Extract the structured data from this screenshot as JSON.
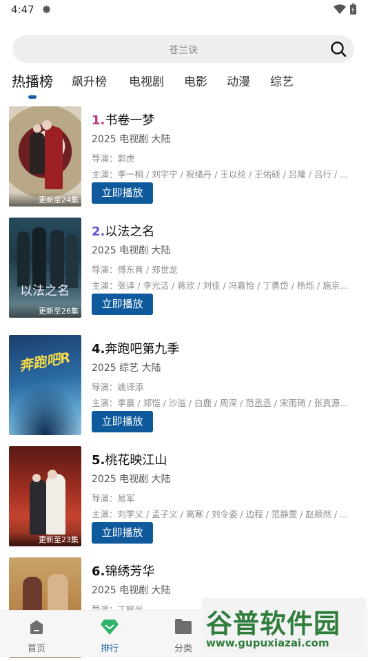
{
  "status": {
    "time": "4:47"
  },
  "search": {
    "placeholder": "苍兰诀"
  },
  "tabs": [
    {
      "label": "热播榜"
    },
    {
      "label": "飙升榜"
    },
    {
      "label": "电视剧"
    },
    {
      "label": "电影"
    },
    {
      "label": "动漫"
    },
    {
      "label": "综艺"
    }
  ],
  "items": [
    {
      "rank": "1.",
      "title": "书卷一梦",
      "meta": "2025  电视剧  大陆",
      "director": "导演：郭虎",
      "cast": "主演：李一桐 / 刘宇宁 / 祝绪丹 / 王以纶 / 王佑硕 / 吕隆 / 吕行 / ...",
      "episodes": "更新至24集",
      "rank_color": "#c2307a"
    },
    {
      "rank": "2.",
      "title": "以法之名",
      "meta": "2025  电视剧  大陆",
      "director": "导演：傅东育 / 郑世龙",
      "cast": "主演：张译 / 李光洁 / 蒋欣 / 刘佳 / 冯嘉怡 / 丁勇岱 / 杨烁 / 施京...",
      "episodes": "更新至26集",
      "rank_color": "#6a4fd0"
    },
    {
      "rank": "4.",
      "title": "奔跑吧第九季",
      "meta": "2025  综艺  大陆",
      "director": "导演：姚译添",
      "cast": "主演：李晨 / 郑恺 / 沙溢 / 白鹿 / 周深 / 范丞丞 / 宋雨琦 / 张真源...",
      "episodes": "",
      "rank_color": "#111111"
    },
    {
      "rank": "5.",
      "title": "桃花映江山",
      "meta": "2025  电视剧  大陆",
      "director": "导演：易军",
      "cast": "主演：刘学义 / 孟子义 / 高寒 / 刘令姿 / 边程 / 范静雯 / 赵顺然 / ...",
      "episodes": "更新至23集",
      "rank_color": "#111111"
    },
    {
      "rank": "6.",
      "title": "锦绣芳华",
      "meta": "2025  电视剧  大陆",
      "director": "导演：丁梓光",
      "cast": "",
      "episodes": "",
      "rank_color": "#111111"
    }
  ],
  "play_label": "立即播放",
  "nav": [
    {
      "label": "首页"
    },
    {
      "label": "排行"
    },
    {
      "label": "分类"
    }
  ],
  "watermark": {
    "title": "谷普软件园",
    "url": "www.gupuxiazai.com"
  },
  "colors": {
    "accent": "#1a5fa0",
    "button": "#0f5a9c",
    "search_bg": "#efefef"
  }
}
